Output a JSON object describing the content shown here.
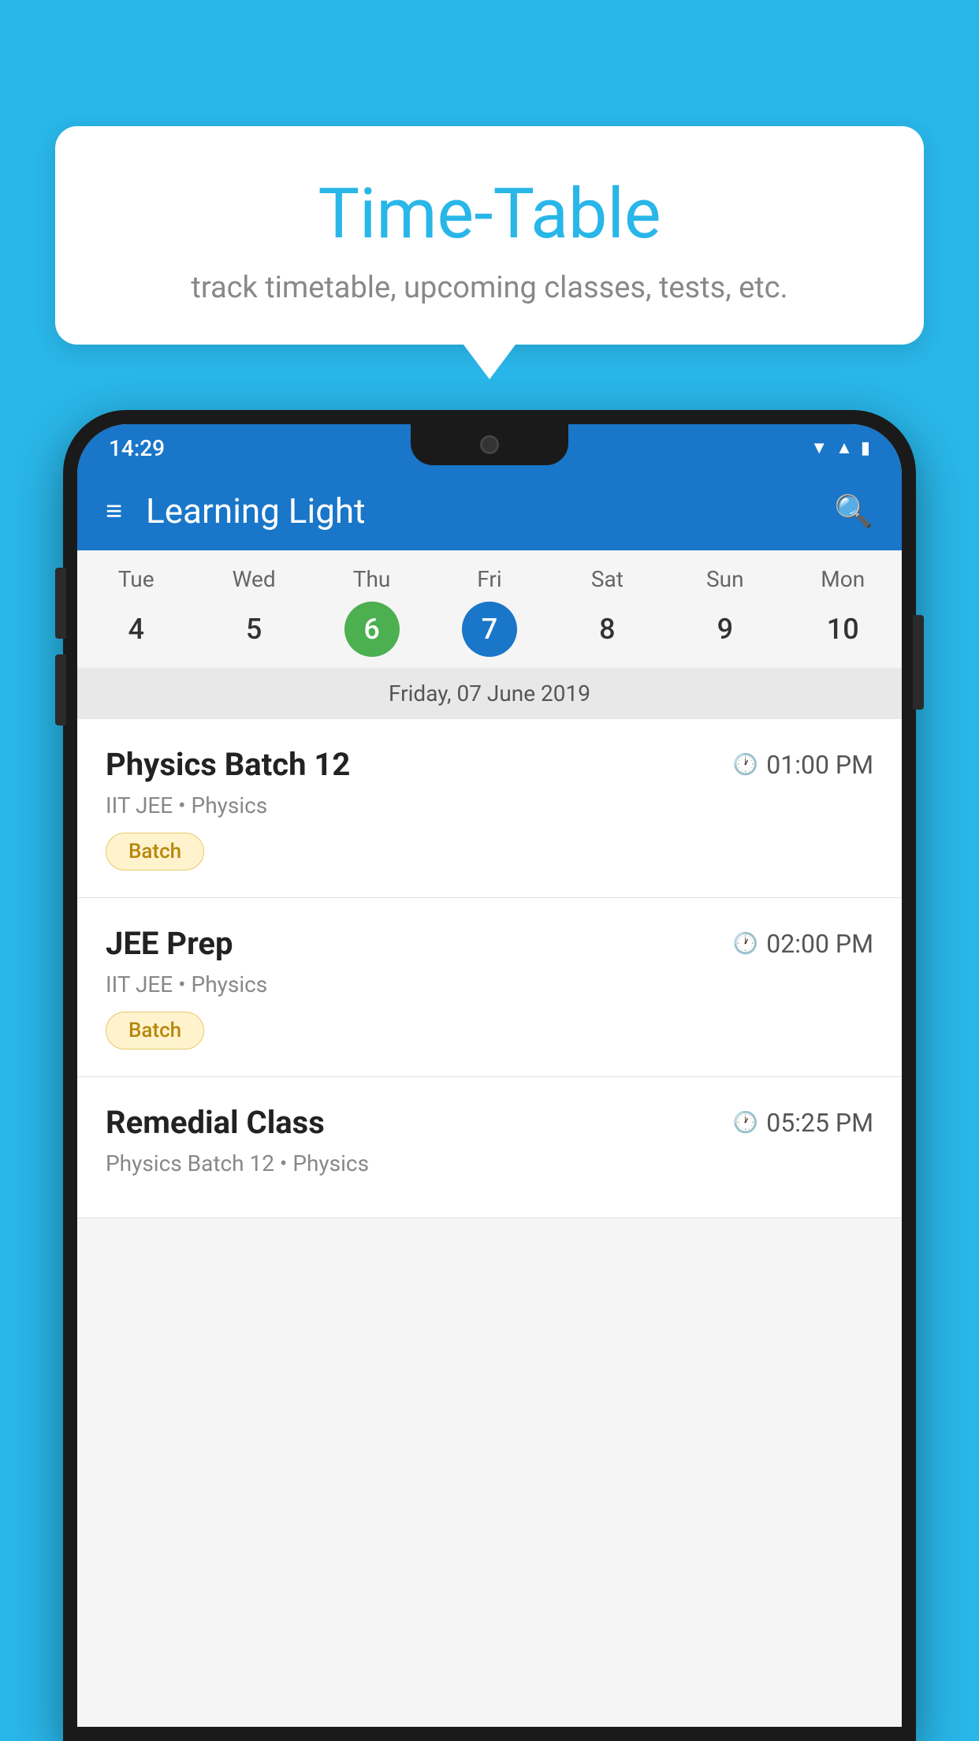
{
  "background_color": "#29B6E8",
  "tooltip": {
    "title": "Time-Table",
    "subtitle": "track timetable, upcoming classes, tests, etc."
  },
  "phone": {
    "status_bar": {
      "time": "14:29",
      "icons": [
        "wifi",
        "signal",
        "battery"
      ]
    },
    "app_bar": {
      "title": "Learning Light",
      "menu_icon": "≡",
      "search_icon": "🔍"
    },
    "calendar": {
      "days": [
        {
          "name": "Tue",
          "num": "4",
          "state": "normal"
        },
        {
          "name": "Wed",
          "num": "5",
          "state": "normal"
        },
        {
          "name": "Thu",
          "num": "6",
          "state": "today"
        },
        {
          "name": "Fri",
          "num": "7",
          "state": "selected"
        },
        {
          "name": "Sat",
          "num": "8",
          "state": "normal"
        },
        {
          "name": "Sun",
          "num": "9",
          "state": "normal"
        },
        {
          "name": "Mon",
          "num": "10",
          "state": "normal"
        }
      ],
      "selected_date_label": "Friday, 07 June 2019"
    },
    "schedule_items": [
      {
        "title": "Physics Batch 12",
        "time": "01:00 PM",
        "meta": "IIT JEE • Physics",
        "tag": "Batch"
      },
      {
        "title": "JEE Prep",
        "time": "02:00 PM",
        "meta": "IIT JEE • Physics",
        "tag": "Batch"
      },
      {
        "title": "Remedial Class",
        "time": "05:25 PM",
        "meta": "Physics Batch 12 • Physics",
        "tag": ""
      }
    ]
  }
}
